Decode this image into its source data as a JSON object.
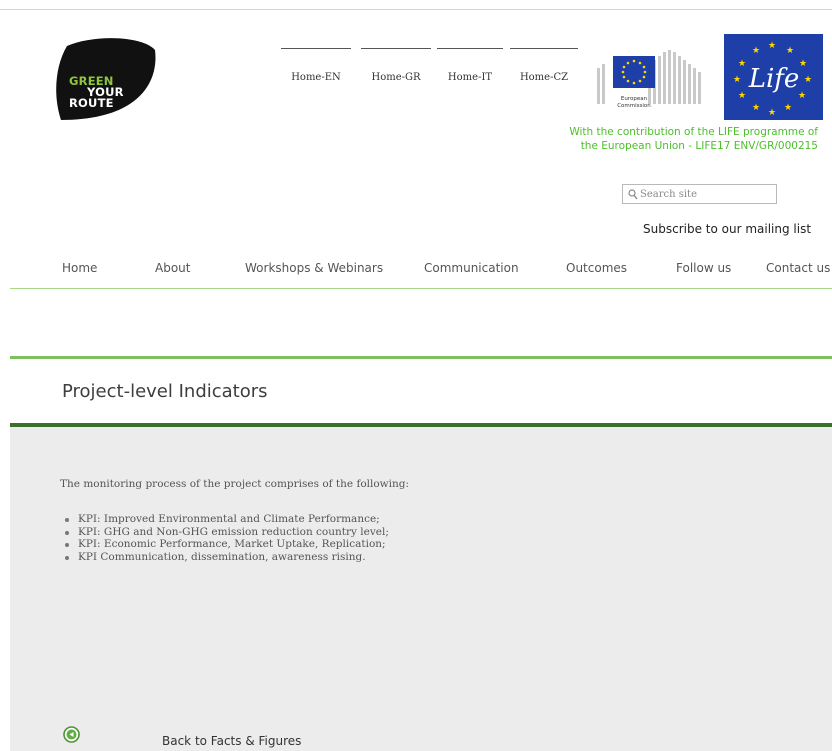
{
  "logo": {
    "line1": "GREEN",
    "line2": "YOUR",
    "line3": "ROUTE",
    "dark_color": "#111111",
    "accent_color": "#8cc63f"
  },
  "language_nav": [
    {
      "label": "Home-EN"
    },
    {
      "label": "Home-GR"
    },
    {
      "label": "Home-IT"
    },
    {
      "label": "Home-CZ"
    }
  ],
  "ec_logo": {
    "line1": "European",
    "line2": "Commission"
  },
  "life_logo": {
    "text": "Life",
    "bg_color": "#1f3fa8",
    "star_color": "#ffd700"
  },
  "contribution": {
    "line1": "With the contribution of the LIFE programme of",
    "line2": "the European Union - LIFE17 ENV/GR/000215",
    "color": "#4bbf2a"
  },
  "search": {
    "placeholder": "Search site",
    "icon": "search-icon"
  },
  "subscribe_label": "Subscribe to our mailing list",
  "main_nav": [
    {
      "label": "Home"
    },
    {
      "label": "About"
    },
    {
      "label": "Workshops & Webinars"
    },
    {
      "label": "Communication"
    },
    {
      "label": "Outcomes"
    },
    {
      "label": "Follow us"
    },
    {
      "label": "Contact us"
    }
  ],
  "page": {
    "title": "Project-level Indicators",
    "intro": "The monitoring process of the project comprises of the following:",
    "kpis": [
      "KPI: Improved Environmental and Climate Performance;",
      "KPI: GHG and Non-GHG emission reduction country level;",
      "KPI: Economic Performance, Market Uptake, Replication;",
      "KPI Communication, dissemination, awareness rising."
    ],
    "back_label": "Back to Facts & Figures",
    "back_icon": "arrow-left-circle-icon"
  },
  "colors": {
    "green_accent": "#7fbf5d",
    "dark_green": "#3c6e2c",
    "content_bg": "#ececec"
  }
}
